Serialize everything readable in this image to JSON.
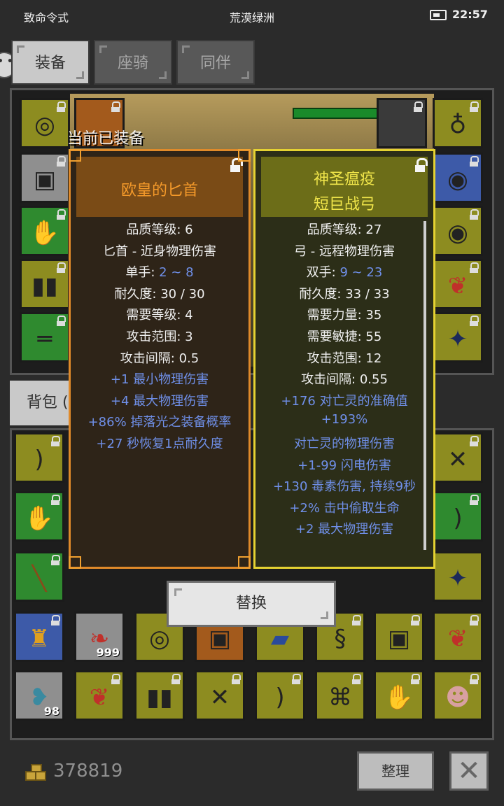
{
  "status_bar": {
    "left_text": "致命令式",
    "location": "荒漠绿洲",
    "time": "22:57"
  },
  "tabs": [
    "装备",
    "座骑",
    "同伴"
  ],
  "equipped_label": "当前已装备",
  "bag_tab": "背包 (",
  "equipped_item": {
    "name": "欧皇的匕首",
    "lines": [
      {
        "text": "品质等级: 6"
      },
      {
        "text": "匕首 - 近身物理伤害"
      },
      {
        "prefix": "单手: ",
        "value": "2 ~ 8"
      },
      {
        "text": "耐久度: 30 / 30"
      },
      {
        "text": "需要等级: 4"
      },
      {
        "text": "攻击范围: 3"
      },
      {
        "text": "攻击间隔: 0.5"
      },
      {
        "blue": "+1 最小物理伤害"
      },
      {
        "blue": "+4 最大物理伤害"
      },
      {
        "blue": "+86% 掉落光之装备概率"
      },
      {
        "blue": "+27 秒恢复1点耐久度"
      }
    ]
  },
  "compare_item": {
    "name_line1": "神圣瘟疫",
    "name_line2": "短巨战弓",
    "lines": [
      {
        "text": "品质等级: 27"
      },
      {
        "text": "弓 - 远程物理伤害"
      },
      {
        "prefix": "双手: ",
        "value": "9 ~ 23"
      },
      {
        "text": "耐久度: 33 / 33"
      },
      {
        "text": "需要力量: 35"
      },
      {
        "text": "需要敏捷: 55"
      },
      {
        "text": "攻击范围: 12"
      },
      {
        "text": "攻击间隔: 0.55"
      },
      {
        "blue": "+176 对亡灵的准确值"
      },
      {
        "blue": "+193%"
      },
      {
        "blue": "对亡灵的物理伤害"
      },
      {
        "blue": "+1-99 闪电伤害"
      },
      {
        "blue": "+130 毒素伤害, 持续9秒"
      },
      {
        "blue": "+2% 击中偷取生命"
      },
      {
        "blue": "+2 最大物理伤害"
      }
    ]
  },
  "replace_button": "替换",
  "gold": "378819",
  "sort_button": "整理",
  "close_icon": "✕",
  "bag_counts": {
    "feather": "999",
    "fish": "98"
  },
  "colors": {
    "quality_orange": "#e08a2a",
    "quality_yellow": "#e5d232",
    "stat_blue": "#6f8fe8"
  }
}
